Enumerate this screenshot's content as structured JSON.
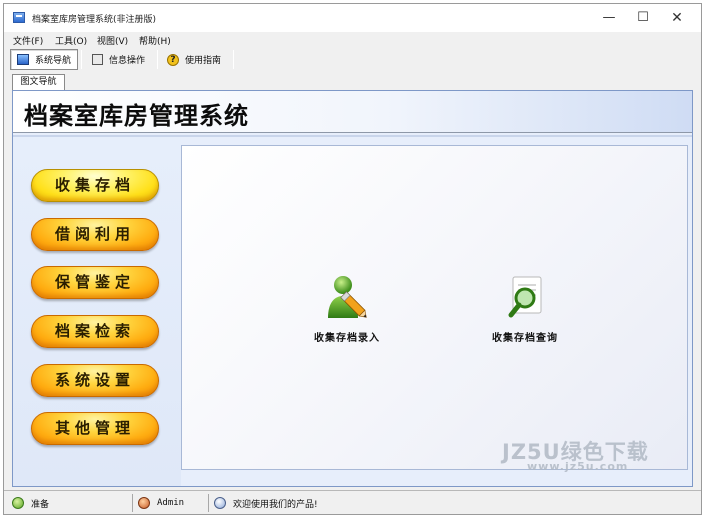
{
  "window": {
    "title": "档案室库房管理系统(非注册版)",
    "controls": {
      "minimize": "—",
      "maximize": "☐",
      "close": "✕"
    }
  },
  "menu": [
    "文件(F)",
    "工具(O)",
    "视图(V)",
    "帮助(H)"
  ],
  "toolbar": [
    {
      "label": "系统导航",
      "icon": "monitor-icon",
      "active": true
    },
    {
      "label": "信息操作",
      "icon": "sheet-icon",
      "active": false
    },
    {
      "label": "使用指南",
      "icon": "help-icon",
      "active": false
    }
  ],
  "subtab": {
    "label": "图文导航"
  },
  "system_title": "档案室库房管理系统",
  "nav_buttons": [
    {
      "label": "收集存档",
      "selected": true
    },
    {
      "label": "借阅利用",
      "selected": false
    },
    {
      "label": "保管鉴定",
      "selected": false
    },
    {
      "label": "档案检索",
      "selected": false
    },
    {
      "label": "系统设置",
      "selected": false
    },
    {
      "label": "其他管理",
      "selected": false
    }
  ],
  "features": [
    {
      "label": "收集存档录入",
      "icon": "user-edit-icon"
    },
    {
      "label": "收集存档查询",
      "icon": "document-search-icon"
    }
  ],
  "watermark": {
    "line1": "JZ5U绿色下载",
    "line2": "www.jz5u.com"
  },
  "status": {
    "ready": "准备",
    "user": "Admin",
    "welcome": "欢迎使用我们的产品!"
  },
  "colors": {
    "nav_button_gold": "#ffae12",
    "nav_button_selected": "#ffe01a",
    "content_bg": "#e7eefb",
    "header_gradient_end": "#cfdcf4"
  }
}
